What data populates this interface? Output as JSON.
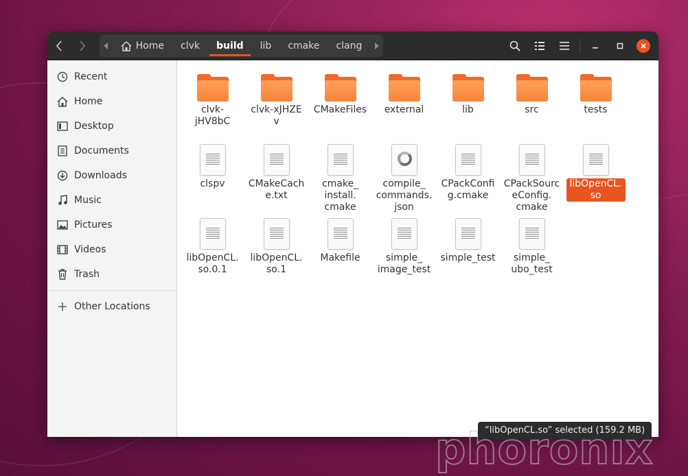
{
  "headerbar": {
    "back_label": "Back",
    "forward_label": "Forward",
    "breadcrumbs": [
      {
        "label": "Home",
        "icon": "home-icon"
      },
      {
        "label": "clvk"
      },
      {
        "label": "build",
        "active": true
      },
      {
        "label": "lib"
      },
      {
        "label": "cmake"
      },
      {
        "label": "clang"
      }
    ],
    "icons": [
      "search-icon",
      "list-view-icon",
      "menu-icon",
      "minimize-icon",
      "maximize-icon",
      "close-icon"
    ]
  },
  "sidebar": {
    "items": [
      {
        "label": "Recent",
        "icon": "clock-icon"
      },
      {
        "label": "Home",
        "icon": "home-icon"
      },
      {
        "label": "Desktop",
        "icon": "desktop-icon"
      },
      {
        "label": "Documents",
        "icon": "document-icon"
      },
      {
        "label": "Downloads",
        "icon": "download-icon"
      },
      {
        "label": "Music",
        "icon": "music-icon"
      },
      {
        "label": "Pictures",
        "icon": "picture-icon"
      },
      {
        "label": "Videos",
        "icon": "video-icon"
      },
      {
        "label": "Trash",
        "icon": "trash-icon"
      }
    ],
    "other_locations": {
      "label": "Other Locations",
      "icon": "plus-icon"
    }
  },
  "files": [
    {
      "name": "clvk-\njHV8bC",
      "type": "folder"
    },
    {
      "name": "clvk-xJHZEv",
      "type": "folder"
    },
    {
      "name": "CMakeFiles",
      "type": "folder"
    },
    {
      "name": "external",
      "type": "folder"
    },
    {
      "name": "lib",
      "type": "folder"
    },
    {
      "name": "src",
      "type": "folder"
    },
    {
      "name": "tests",
      "type": "folder"
    },
    {
      "name": "clspv",
      "type": "text"
    },
    {
      "name": "CMakeCach\ne.txt",
      "type": "text"
    },
    {
      "name": "cmake_\ninstall.\ncmake",
      "type": "text"
    },
    {
      "name": "compile_\ncommands.\njson",
      "type": "json"
    },
    {
      "name": "CPackConfi\ng.cmake",
      "type": "text"
    },
    {
      "name": "CPackSourc\neConfig.\ncmake",
      "type": "text"
    },
    {
      "name": "libOpenCL.\nso",
      "type": "text",
      "selected": true
    },
    {
      "name": "libOpenCL.\nso.0.1",
      "type": "text"
    },
    {
      "name": "libOpenCL.\nso.1",
      "type": "text"
    },
    {
      "name": "Makefile",
      "type": "text"
    },
    {
      "name": "simple_\nimage_test",
      "type": "text"
    },
    {
      "name": "simple_test",
      "type": "text"
    },
    {
      "name": "simple_\nubo_test",
      "type": "text"
    }
  ],
  "status": {
    "text": "“libOpenCL.so” selected  (159.2 MB)"
  },
  "watermark": {
    "text": "phoronix"
  },
  "colors": {
    "accent": "#e95420",
    "headerbar": "#2c2c2c",
    "folder": "#f7853a"
  }
}
